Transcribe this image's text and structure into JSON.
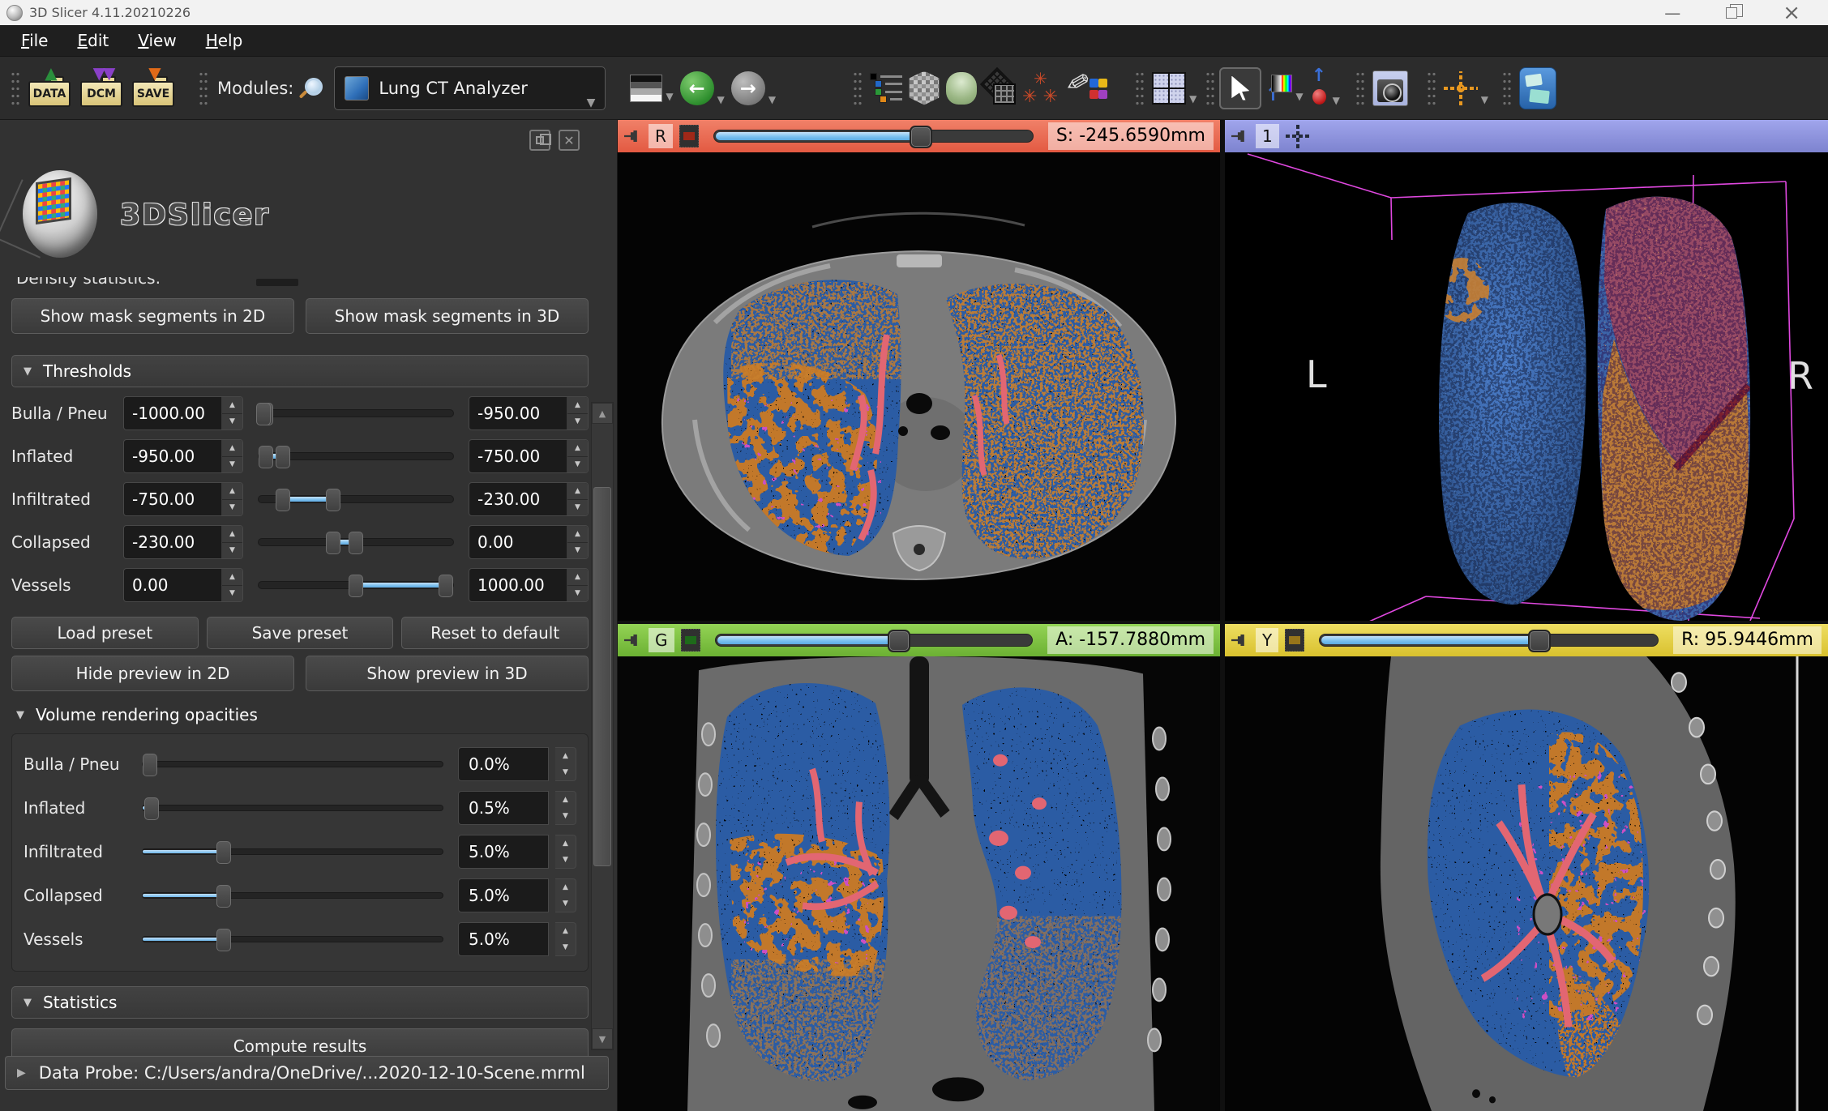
{
  "window": {
    "title": "3D Slicer 4.11.20210226"
  },
  "menu": {
    "items": [
      "File",
      "Edit",
      "View",
      "Help"
    ]
  },
  "toolbar": {
    "modules_label": "Modules:",
    "module_selector": {
      "value": "Lung CT Analyzer"
    },
    "load_icons": {
      "data": "DATA",
      "dcm": "DCM",
      "save": "SAVE"
    },
    "icon_names": [
      "drag-handle",
      "load-data-icon",
      "import-dicom-icon",
      "save-icon",
      "module-search-icon",
      "module-combo",
      "window-level-icon",
      "history-back-icon",
      "history-forward-icon",
      "subject-hierarchy-icon",
      "volume-rendering-icon",
      "models-icon",
      "segmentation-mesh-icon",
      "markups-icon",
      "annotations-pen-icon",
      "layout-selector-icon",
      "mouse-mode-cursor-icon",
      "colors-icon",
      "place-fiducial-icon",
      "screenshot-icon",
      "crosshair-icon",
      "extensions-icon"
    ]
  },
  "panel": {
    "logo_text": "3DSlicer",
    "clipped_label": "Density statistics:",
    "mask_buttons": {
      "show_2d": "Show mask segments in 2D",
      "show_3d": "Show mask segments in 3D"
    },
    "thresholds": {
      "title": "Thresholds",
      "rows": [
        {
          "label": "Bulla / Pneu",
          "low": "-1000.00",
          "high": "-950.00",
          "low_pct": 0,
          "high_pct": 2.5
        },
        {
          "label": "Inflated",
          "low": "-950.00",
          "high": "-750.00",
          "low_pct": 2.5,
          "high_pct": 12.5
        },
        {
          "label": "Infiltrated",
          "low": "-750.00",
          "high": "-230.00",
          "low_pct": 12.5,
          "high_pct": 38.5
        },
        {
          "label": "Collapsed",
          "low": "-230.00",
          "high": "0.00",
          "low_pct": 38.5,
          "high_pct": 50
        },
        {
          "label": "Vessels",
          "low": "0.00",
          "high": "1000.00",
          "low_pct": 50,
          "high_pct": 100
        }
      ]
    },
    "preset_buttons": [
      "Load preset",
      "Save preset",
      "Reset to default"
    ],
    "preview_buttons": [
      "Hide preview in 2D",
      "Show preview in 3D"
    ],
    "opacities": {
      "title": "Volume rendering opacities",
      "rows": [
        {
          "label": "Bulla / Pneu",
          "value": "0.0%",
          "pct": 0
        },
        {
          "label": "Inflated",
          "value": "0.5%",
          "pct": 3
        },
        {
          "label": "Infiltrated",
          "value": "5.0%",
          "pct": 27
        },
        {
          "label": "Collapsed",
          "value": "5.0%",
          "pct": 27
        },
        {
          "label": "Vessels",
          "value": "5.0%",
          "pct": 27
        }
      ]
    },
    "statistics": {
      "title": "Statistics",
      "compute_button": "Compute results"
    },
    "data_probe": "Data Probe: C:/Users/andra/OneDrive/...2020-12-10-Scene.mrml"
  },
  "viewports": {
    "red": {
      "label": "R",
      "readout": "S: -245.6590mm",
      "slider_pct": 65
    },
    "threeD": {
      "label": "1",
      "left_marker": "L",
      "right_marker": "R"
    },
    "green": {
      "label": "G",
      "readout": "A: -157.7880mm",
      "slider_pct": 58
    },
    "yellow": {
      "label": "Y",
      "readout": "R: 95.9446mm",
      "slider_pct": 65
    }
  },
  "colors": {
    "red_bar": "#e35a42",
    "green_bar": "#6cb133",
    "yellow_bar": "#d9c12e",
    "threeD_bar": "#7d83cf",
    "slider_fill": "#7cc2f0",
    "accent_blue": "#6cb6ea",
    "seg_inflated_blue": "#2b5ca4",
    "seg_infiltrated_orange": "#c2782a",
    "seg_collapsed_magenta": "#cc4fc4",
    "seg_vessel_pink": "#e26672"
  }
}
